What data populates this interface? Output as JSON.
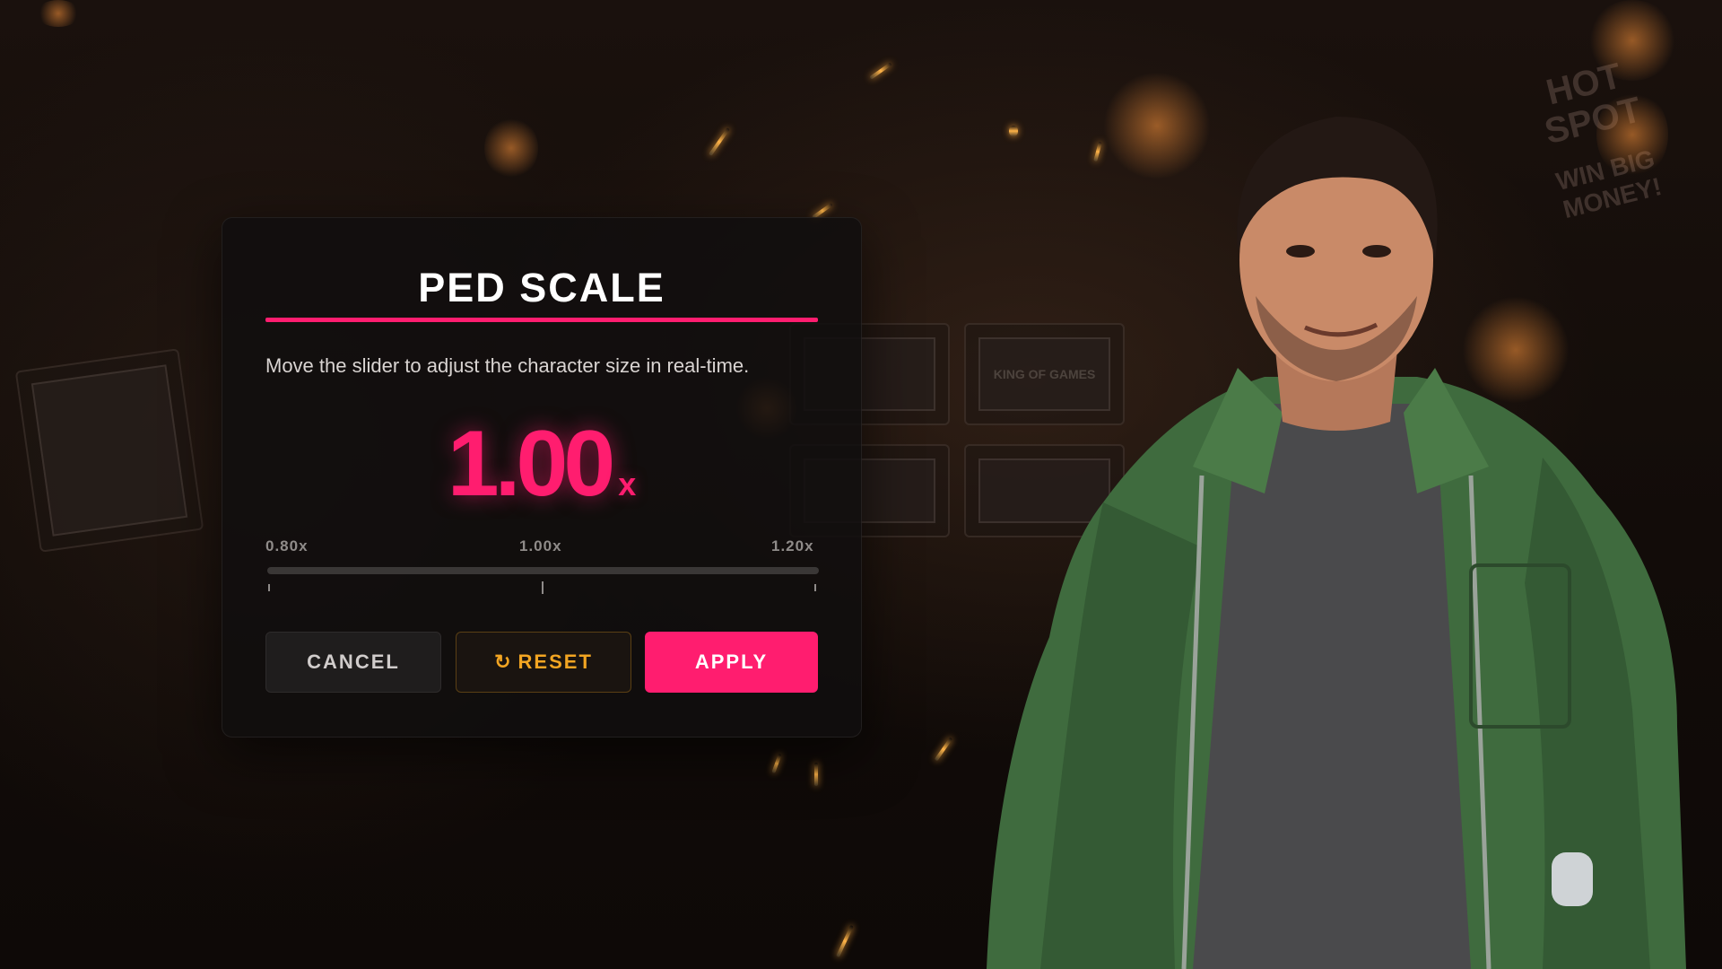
{
  "dialog": {
    "title": "PED SCALE",
    "description": "Move the slider to adjust the character size in real-time.",
    "value": "1.00",
    "unit": "x",
    "slider": {
      "min_label": "0.80x",
      "mid_label": "1.00x",
      "max_label": "1.20x",
      "min": 0.8,
      "max": 1.2,
      "current": 1.0
    },
    "buttons": {
      "cancel": "CANCEL",
      "reset_icon": "↻",
      "reset": "RESET",
      "apply": "APPLY"
    }
  },
  "background": {
    "signs": [
      "KING OF GAMES",
      "HOT SPOT",
      "WIN BIG MONEY!"
    ]
  },
  "colors": {
    "accent": "#ff1d6f",
    "reset": "#f2a522",
    "panel": "#100e0e"
  },
  "icons": {
    "reset": "refresh-icon"
  }
}
